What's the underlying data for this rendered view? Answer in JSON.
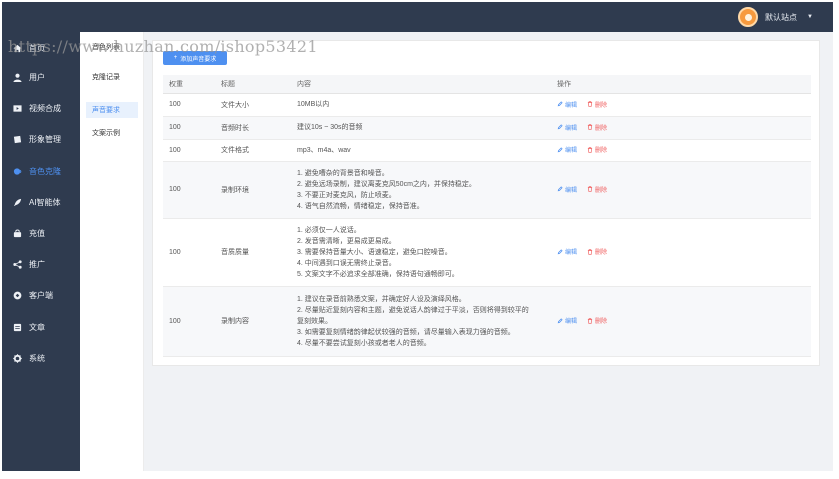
{
  "header": {
    "site_name": "默认站点",
    "avatar_icon": "orange-circle-avatar"
  },
  "sidebar": {
    "items": [
      {
        "label": "首页",
        "icon": "home-icon"
      },
      {
        "label": "用户",
        "icon": "user-icon"
      },
      {
        "label": "视频合成",
        "icon": "video-icon"
      },
      {
        "label": "形象管理",
        "icon": "image-icon"
      },
      {
        "label": "音色克隆",
        "icon": "voice-icon",
        "active": true
      },
      {
        "label": "AI智能体",
        "icon": "rocket-icon"
      },
      {
        "label": "充值",
        "icon": "wallet-icon"
      },
      {
        "label": "推广",
        "icon": "share-icon"
      },
      {
        "label": "客户端",
        "icon": "client-icon"
      },
      {
        "label": "文章",
        "icon": "article-icon"
      },
      {
        "label": "系统",
        "icon": "gear-icon"
      }
    ]
  },
  "subnav": {
    "items": [
      {
        "label": "音色列表"
      },
      {
        "label": "克隆记录"
      },
      {
        "label": "声音要求",
        "active": true
      },
      {
        "label": "文案示例"
      }
    ]
  },
  "toolbar": {
    "add_label": "添加声音要求"
  },
  "table": {
    "columns": {
      "weight": "权重",
      "title": "标题",
      "content": "内容",
      "actions": "操作"
    },
    "edit_label": "编辑",
    "delete_label": "删除",
    "rows": [
      {
        "weight": "100",
        "title": "文件大小",
        "content": [
          "10MB以内"
        ]
      },
      {
        "weight": "100",
        "title": "音频时长",
        "content": [
          "建议10s ~ 30s的音频"
        ]
      },
      {
        "weight": "100",
        "title": "文件格式",
        "content": [
          "mp3、m4a、wav"
        ]
      },
      {
        "weight": "100",
        "title": "录制环境",
        "content": [
          "1. 避免嘈杂的背景音和噪音。",
          "2. 避免远场录制，建议离麦克风50cm之内，并保持稳定。",
          "3. 不要正对麦克风，防止喷麦。",
          "4. 语气自然流畅，情绪稳定，保持音准。"
        ]
      },
      {
        "weight": "100",
        "title": "音质质量",
        "content": [
          "1. 必须仅一人说话。",
          "2. 发音需清晰，更易成更易成。",
          "3. 需要保持音量大小、语速稳定，避免口腔噪音。",
          "4. 中间遇到口误无需终止录音。",
          "5. 文案文字不必追求全部准确，保持语句通畅即可。"
        ]
      },
      {
        "weight": "100",
        "title": "录制内容",
        "content": [
          "1. 建议在录音前熟悉文案，并确定好人设及演绎风格。",
          "2. 尽量贴近复刻内容和主题，避免说话人韵律过于平淡，否则将得到较平的",
          "复刻效果。",
          "3. 如需要复刻情绪韵律起伏较强的音频，请尽量输入表现力强的音频。",
          "4. 尽量不要尝试复刻小孩或者老人的音频。"
        ]
      }
    ]
  },
  "watermark": "https://www.huzhan.com/ishop53421",
  "colors": {
    "sidebar_bg": "#2f3b4f",
    "accent": "#4e90f0",
    "danger": "#f05b5b",
    "avatar": "#f79a3e"
  }
}
